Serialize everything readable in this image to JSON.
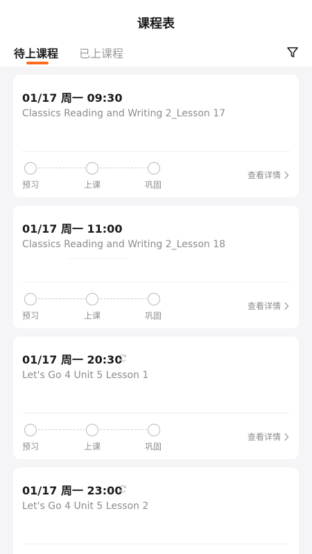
{
  "header": {
    "title": "课程表",
    "tabs": [
      {
        "label": "待上课程",
        "active": true
      },
      {
        "label": "已上课程",
        "active": false
      }
    ],
    "accent_color": "#ff6a1a",
    "filter_icon": "filter-icon"
  },
  "courses": [
    {
      "time": "01/17 周一 09:30",
      "title": "Classics Reading and Writing 2_Lesson 17",
      "synced": false,
      "steps": [
        "预习",
        "上课",
        "巩固"
      ],
      "detail_label": "查看详情"
    },
    {
      "time": "01/17 周一 11:00",
      "title": "Classics Reading and Writing 2_Lesson 18",
      "synced": false,
      "steps": [
        "预习",
        "上课",
        "巩固"
      ],
      "detail_label": "查看详情"
    },
    {
      "time": "01/17 周一 20:30",
      "title": "Let's Go 4 Unit 5 Lesson 1",
      "synced": true,
      "steps": [
        "预习",
        "上课",
        "巩固"
      ],
      "detail_label": "查看详情"
    },
    {
      "time": "01/17 周一 23:00",
      "title": "Let's Go 4 Unit 5 Lesson 2",
      "synced": true,
      "steps": [],
      "detail_label": ""
    }
  ]
}
